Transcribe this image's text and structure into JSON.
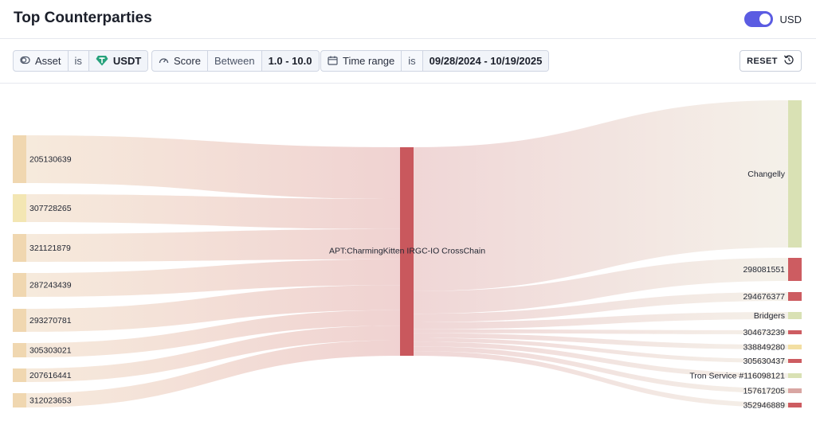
{
  "header": {
    "title": "Top Counterparties",
    "currency_label": "USD",
    "currency_toggle_on": true
  },
  "filters": {
    "asset": {
      "field": "Asset",
      "op": "is",
      "value": "USDT"
    },
    "score": {
      "field": "Score",
      "op": "Between",
      "value": "1.0 - 10.0"
    },
    "time_range": {
      "field": "Time range",
      "op": "is",
      "value": "09/28/2024 - 10/19/2025"
    },
    "reset_label": "RESET"
  },
  "colors": {
    "accent": "#5b5ce2",
    "center": "#c9585d",
    "tan": "#f0d7b0",
    "lightyellow": "#f3e6b3",
    "green": "#d9e1b4",
    "red": "#cd5c61",
    "pink": "#d9a6a3",
    "yellow": "#f3dfa2"
  },
  "chart_data": {
    "type": "sankey",
    "center": {
      "label": "APT:CharmingKitten IRGC-IO CrossChain"
    },
    "sources": [
      {
        "label": "205130639",
        "color": "tan"
      },
      {
        "label": "307728265",
        "color": "lightyellow"
      },
      {
        "label": "321121879",
        "color": "tan"
      },
      {
        "label": "287243439",
        "color": "tan"
      },
      {
        "label": "293270781",
        "color": "tan"
      },
      {
        "label": "305303021",
        "color": "tan"
      },
      {
        "label": "207616441",
        "color": "tan"
      },
      {
        "label": "312023653",
        "color": "tan"
      }
    ],
    "targets": [
      {
        "label": "Changelly",
        "color": "green"
      },
      {
        "label": "298081551",
        "color": "red"
      },
      {
        "label": "294676377",
        "color": "red"
      },
      {
        "label": "Bridgers",
        "color": "green"
      },
      {
        "label": "304673239",
        "color": "red"
      },
      {
        "label": "338849280",
        "color": "yellow"
      },
      {
        "label": "305630437",
        "color": "red"
      },
      {
        "label": "Tron Service #116098121",
        "color": "green"
      },
      {
        "label": "157617205",
        "color": "pink"
      },
      {
        "label": "352946889",
        "color": "red"
      }
    ]
  }
}
